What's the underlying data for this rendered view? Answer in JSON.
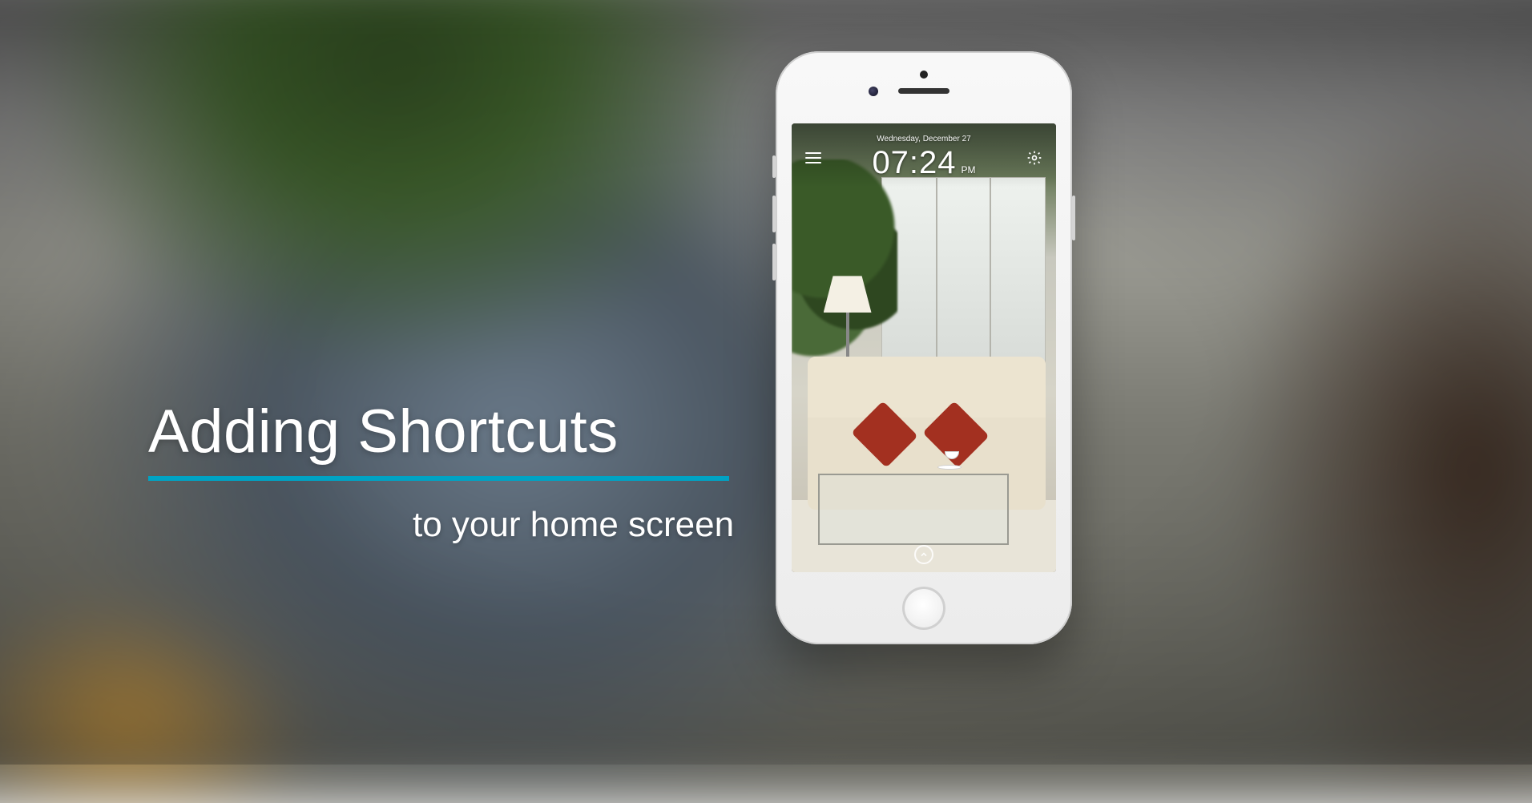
{
  "title": {
    "main": "Adding Shortcuts",
    "sub": "to your home screen",
    "accent_color": "#00a3c4"
  },
  "phone": {
    "app": {
      "date": "Wednesday, December 27",
      "time": "07:24",
      "ampm": "PM",
      "menu_icon": "hamburger-icon",
      "settings_icon": "gear-icon",
      "expand_icon": "chevron-up-icon"
    }
  }
}
